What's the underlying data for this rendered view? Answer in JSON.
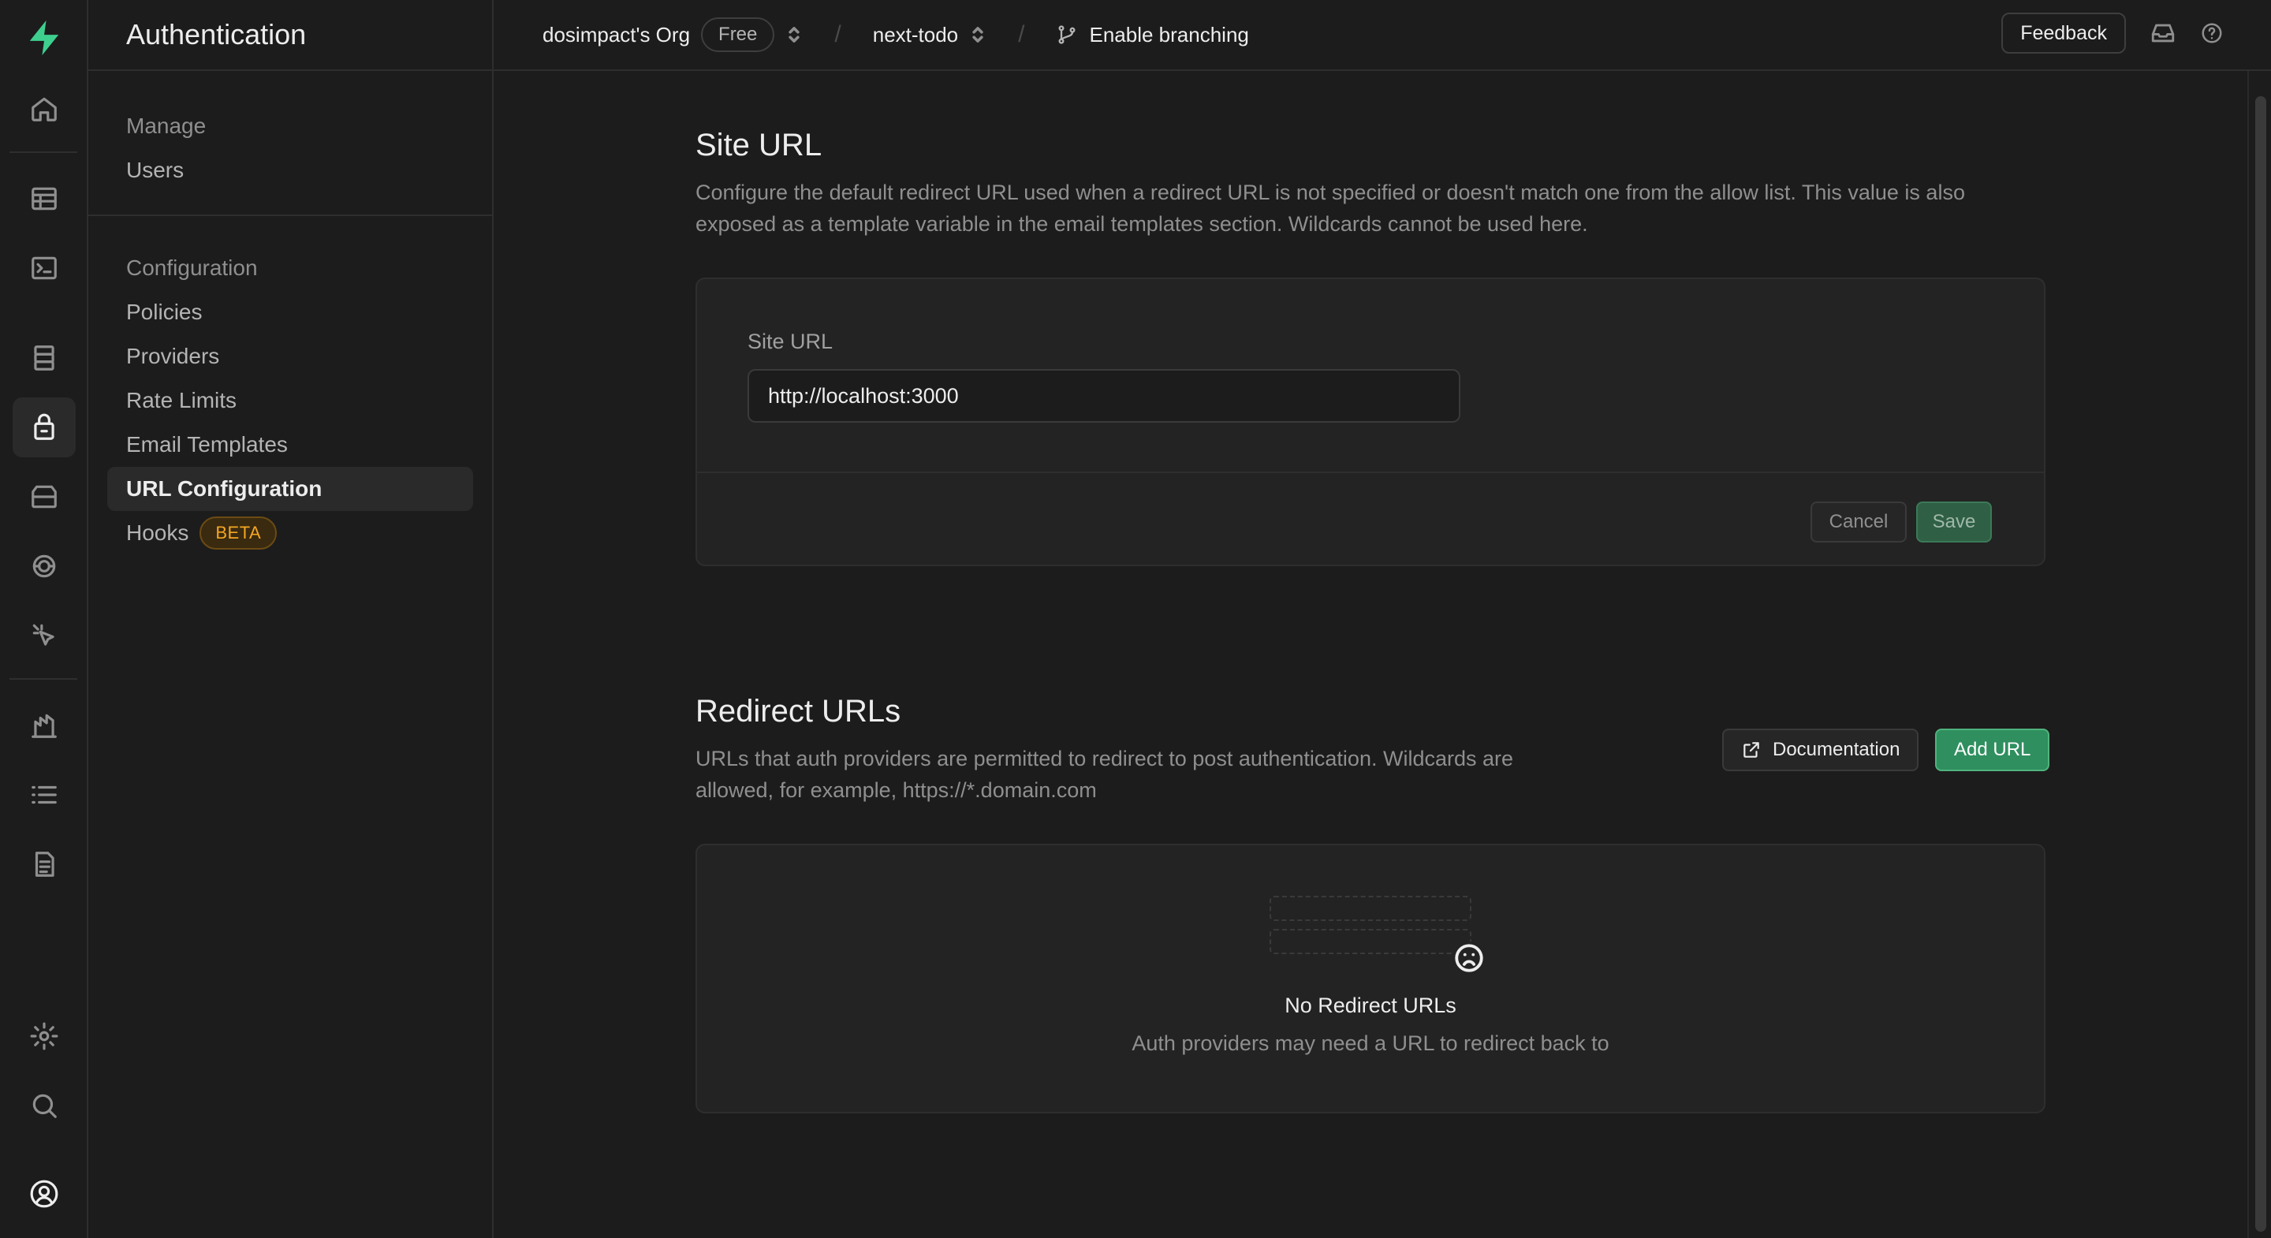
{
  "app": {
    "section_title": "Authentication"
  },
  "rail": {
    "icons": [
      "supabase-logo",
      "home-icon",
      "table-editor-icon",
      "sql-editor-icon",
      "database-icon",
      "auth-icon",
      "storage-icon",
      "realtime-icon",
      "edge-functions-icon",
      "reports-icon",
      "logs-icon",
      "docs-icon",
      "settings-icon",
      "search-icon",
      "user-avatar-icon"
    ],
    "active": "auth-icon"
  },
  "sidebar": {
    "manage": {
      "title": "Manage",
      "items": [
        {
          "label": "Users"
        }
      ]
    },
    "configuration": {
      "title": "Configuration",
      "items": [
        {
          "label": "Policies"
        },
        {
          "label": "Providers"
        },
        {
          "label": "Rate Limits"
        },
        {
          "label": "Email Templates"
        },
        {
          "label": "URL Configuration",
          "active": true
        },
        {
          "label": "Hooks",
          "badge": "BETA"
        }
      ]
    }
  },
  "topbar": {
    "org": "dosimpact's Org",
    "plan": "Free",
    "project": "next-todo",
    "branching": "Enable branching",
    "feedback": "Feedback"
  },
  "site_url": {
    "title": "Site URL",
    "description_line1": "Configure the default redirect URL used when a redirect URL is not specified or doesn't match one from the allow list. This value is also",
    "description_line2": "exposed as a template variable in the email templates section. Wildcards cannot be used here.",
    "field_label": "Site URL",
    "field_value": "http://localhost:3000",
    "cancel": "Cancel",
    "save": "Save"
  },
  "redirect_urls": {
    "title": "Redirect URLs",
    "description_line1": "URLs that auth providers are permitted to redirect to post authentication. Wildcards are",
    "description_line2": "allowed, for example, https://*.domain.com",
    "documentation": "Documentation",
    "add_url": "Add URL",
    "empty_title": "No Redirect URLs",
    "empty_subtitle": "Auth providers may need a URL to redirect back to"
  },
  "colors": {
    "background": "#1c1c1c",
    "panel": "#232323",
    "accent_green": "#3ecf8e",
    "beta_orange": "#f5a623"
  }
}
